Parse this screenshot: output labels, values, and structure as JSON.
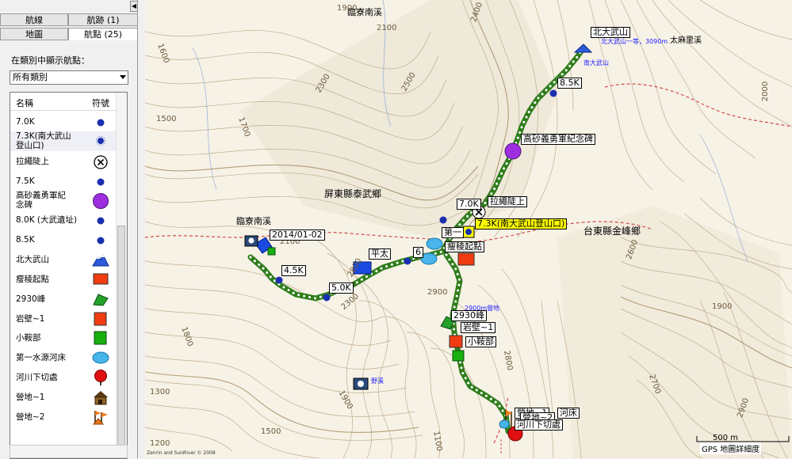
{
  "panel": {
    "tabs_top": [
      "航線",
      "航跡 (1)"
    ],
    "tabs_bottom": [
      "地圖",
      "航點 (25)"
    ],
    "collapse_glyph": "◀",
    "category_prompt": "在類別中顯示航點：",
    "category_value": "所有類別",
    "list_header": {
      "name": "名稱",
      "symbol": "符號"
    },
    "waypoints": [
      {
        "name": "7.0K",
        "symbol": "blue-dot-icon"
      },
      {
        "name": "7.3K(南大武山\n登山口)",
        "symbol": "blue-flower-dot-icon"
      },
      {
        "name": "拉繩陡上",
        "symbol": "x-circle-icon"
      },
      {
        "name": "7.5K",
        "symbol": "blue-dot-icon"
      },
      {
        "name": "高砂義勇軍紀\n念碑",
        "symbol": "purple-circle-icon"
      },
      {
        "name": "8.0K (大武遺址)",
        "symbol": "blue-dot-icon"
      },
      {
        "name": "8.5K",
        "symbol": "blue-dot-icon"
      },
      {
        "name": "北大武山",
        "symbol": "mountain-summit-icon"
      },
      {
        "name": "瘦稜起點",
        "symbol": "red-square-icon"
      },
      {
        "name": "2930峰",
        "symbol": "green-triangle-icon"
      },
      {
        "name": "岩壁~1",
        "symbol": "red-square-icon"
      },
      {
        "name": "小鞍部",
        "symbol": "green-square-icon"
      },
      {
        "name": "第一水源河床",
        "symbol": "water-drop-icon"
      },
      {
        "name": "河川下切處",
        "symbol": "red-pin-icon"
      },
      {
        "name": "營地~1",
        "symbol": "cabin-icon"
      },
      {
        "name": "營地~2",
        "symbol": "camp-flag-icon"
      }
    ]
  },
  "map": {
    "place_labels": {
      "linglao_top": "臨寮南溪",
      "linglao_left": "臨寮南溪",
      "taimali": "太麻里溪",
      "pingtung": "屏東縣泰武鄉",
      "taitung": "台東縣金峰鄉"
    },
    "waypoint_boxes": {
      "beidawu": "北大武山",
      "k85": "8.5K",
      "memorial": "高砂義勇軍紀念碑",
      "lasheng": "拉繩陡上",
      "k70": "7.0K",
      "k73": "7.3K(南大武山登山口)",
      "shouleng": "瘦稜起點",
      "k60": "6",
      "lianggou": "第一",
      "rock": "岩壁~1",
      "peak2930": "2930峰",
      "saddle": "小鞍部",
      "date": "2014/01-02",
      "k45": "4.5K",
      "k50": "5.0K",
      "cross": "平太",
      "camp": "營地~1",
      "camp2": "營地~2",
      "river": "河川下切處",
      "riverbed": "河床"
    },
    "blue_labels": {
      "summit_note": "北大武山一等，3090m",
      "nandawu": "南大武山",
      "camp_note": "2900m營地",
      "lake": "野溪"
    },
    "contour_labels": [
      "1900",
      "2100",
      "2400",
      "1600",
      "2300",
      "2500",
      "1500",
      "1700",
      "2100",
      "2800",
      "2900",
      "2800",
      "1900",
      "1800",
      "2300",
      "1300",
      "1900",
      "1200",
      "1500",
      "1100",
      "2600",
      "2700",
      "2900",
      "2000"
    ],
    "scale": "500 m",
    "source": "GPS 地圖詳細度",
    "copyright": "Zenrin and SunRiver © 2008"
  },
  "colors": {
    "route": "#2f7d1c",
    "route_dots": "#ffffff",
    "contour": "#b7a27e",
    "road": "#d04a4a",
    "waypoint_blue": "#1a2fb0",
    "accent_yellow": "#ffff00"
  }
}
